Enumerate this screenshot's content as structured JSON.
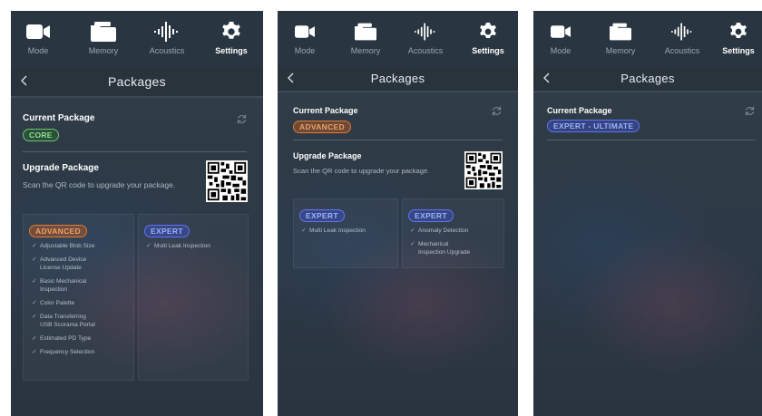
{
  "nav": {
    "items": [
      {
        "label": "Mode",
        "icon": "video-camera-icon"
      },
      {
        "label": "Memory",
        "icon": "folder-icon"
      },
      {
        "label": "Acoustics",
        "icon": "sound-wave-icon"
      },
      {
        "label": "Settings",
        "icon": "gear-icon",
        "active": true
      }
    ]
  },
  "screen": {
    "title": "Packages",
    "back_icon": "chevron-left-icon"
  },
  "current_label": "Current Package",
  "upgrade_label": "Upgrade Package",
  "upgrade_desc": "Scan the QR code to upgrade your package.",
  "panels": [
    {
      "current_badge": "CORE",
      "cards": [
        {
          "badge": "ADVANCED",
          "features": [
            [
              "Adjustable Blob Size"
            ],
            [
              "Advanced Device",
              "License Update"
            ],
            [
              "Basic Mechanical",
              "Inspection"
            ],
            [
              "Color Palette"
            ],
            [
              "Data Transferring",
              "USB Scorama Portal"
            ],
            [
              "Estimated PD Type"
            ],
            [
              "Frequency Selection"
            ]
          ]
        },
        {
          "badge": "EXPERT",
          "features": [
            [
              "Multi Leak Inspection"
            ]
          ]
        }
      ]
    },
    {
      "current_badge": "ADVANCED",
      "cards": [
        {
          "badge": "EXPERT",
          "features": [
            [
              "Multi Leak Inspection"
            ]
          ]
        },
        {
          "badge": "EXPERT",
          "features": [
            [
              "Anomaly Detection"
            ],
            [
              "Mechanical",
              "Inspection Upgrade"
            ]
          ]
        }
      ]
    },
    {
      "current_badge": "EXPERT - ULTIMATE"
    }
  ],
  "colors": {
    "background": "#2e3a46",
    "core": "#6cc46c",
    "advanced": "#e07a37",
    "expert": "#5f74f2"
  }
}
